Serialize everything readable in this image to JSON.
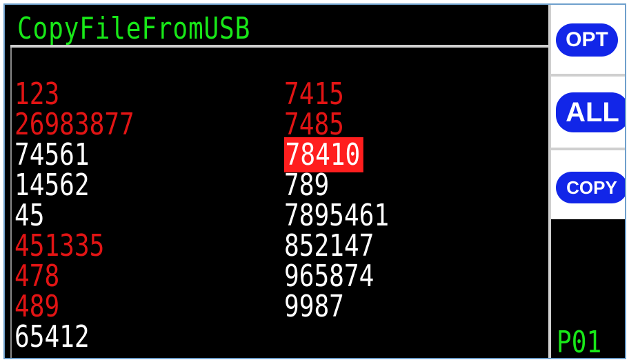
{
  "title": "CopyFileFromUSB",
  "files_left": [
    {
      "name": "123",
      "color": "#e21414",
      "selected": false
    },
    {
      "name": "26983877",
      "color": "#e21414",
      "selected": false
    },
    {
      "name": "74561",
      "color": "#ffffff",
      "selected": false
    },
    {
      "name": "14562",
      "color": "#ffffff",
      "selected": false
    },
    {
      "name": "45",
      "color": "#ffffff",
      "selected": false
    },
    {
      "name": "451335",
      "color": "#e21414",
      "selected": false
    },
    {
      "name": "478",
      "color": "#e21414",
      "selected": false
    },
    {
      "name": "489",
      "color": "#e21414",
      "selected": false
    },
    {
      "name": "65412",
      "color": "#ffffff",
      "selected": false
    }
  ],
  "files_right": [
    {
      "name": "7415",
      "color": "#e21414",
      "selected": false
    },
    {
      "name": "7485",
      "color": "#e21414",
      "selected": false
    },
    {
      "name": "78410",
      "color": "#ffffff",
      "selected": true
    },
    {
      "name": "789",
      "color": "#ffffff",
      "selected": false
    },
    {
      "name": "7895461",
      "color": "#ffffff",
      "selected": false
    },
    {
      "name": "852147",
      "color": "#ffffff",
      "selected": false
    },
    {
      "name": "965874",
      "color": "#ffffff",
      "selected": false
    },
    {
      "name": "9987",
      "color": "#ffffff",
      "selected": false
    }
  ],
  "buttons": {
    "opt": "OPT",
    "all": "ALL",
    "copy": "COPY"
  },
  "page": "P01",
  "colors": {
    "title_green": "#18e818",
    "unselected_red": "#e21414",
    "highlight_red": "#ff1e1e",
    "button_blue": "#1226e8",
    "background": "#000000"
  }
}
